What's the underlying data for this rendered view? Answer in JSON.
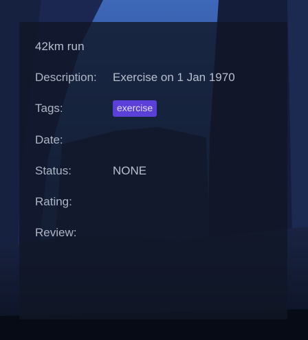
{
  "card": {
    "title": "42km run",
    "fields": {
      "description": {
        "label": "Description:",
        "value": "Exercise on 1 Jan 1970"
      },
      "tags": {
        "label": "Tags:",
        "items": [
          "exercise"
        ]
      },
      "date": {
        "label": "Date:",
        "value": ""
      },
      "status": {
        "label": "Status:",
        "value": "NONE"
      },
      "rating": {
        "label": "Rating:",
        "value": ""
      },
      "review": {
        "label": "Review:",
        "value": ""
      }
    }
  },
  "colors": {
    "tag_background": "#5a3fd8",
    "card_background": "rgba(16,22,38,0.80)",
    "text": "#b8c0cf"
  }
}
